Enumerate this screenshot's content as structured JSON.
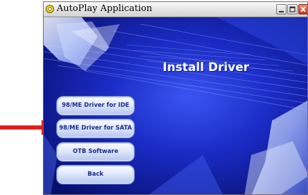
{
  "window": {
    "title": "AutoPlay Application"
  },
  "main": {
    "heading": "Install Driver",
    "buttons": [
      {
        "label": "98/ME Driver for IDE"
      },
      {
        "label": "98/ME Driver for SATA"
      },
      {
        "label": "OTB Software"
      },
      {
        "label": "Back"
      }
    ]
  },
  "icons": {
    "app": "autoplay-app-icon",
    "minimize": "minimize-icon",
    "maximize": "maximize-icon",
    "close": "close-icon",
    "callout": "red-arrow-icon"
  },
  "colors": {
    "background": "#0d1a9a",
    "button_text": "#1a2a8c",
    "heading_text": "#ffffff",
    "arrow": "#e02020"
  }
}
